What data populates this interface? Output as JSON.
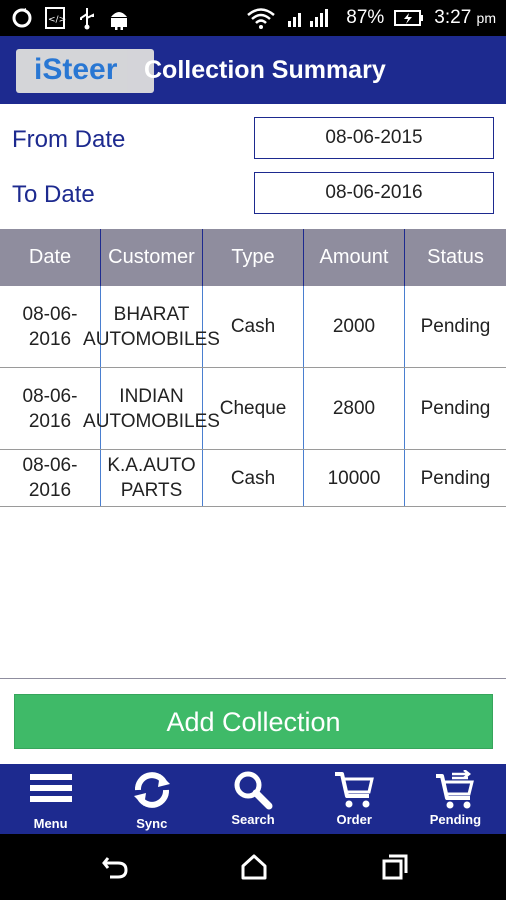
{
  "status_bar": {
    "battery": "87%",
    "time": "3:27",
    "ampm": "pm"
  },
  "header": {
    "logo": "iSteer",
    "title": "Collection Summary"
  },
  "filters": {
    "from_label": "From Date",
    "from_value": "08-06-2015",
    "to_label": "To Date",
    "to_value": "08-06-2016"
  },
  "table": {
    "columns": [
      "Date",
      "Customer",
      "Type",
      "Amount",
      "Status"
    ],
    "rows": [
      {
        "date": "08-06-2016",
        "customer": "BHARAT AUTOMOBILES",
        "type": "Cash",
        "amount": "2000",
        "status": "Pending"
      },
      {
        "date": "08-06-2016",
        "customer": "INDIAN AUTOMOBILES",
        "type": "Cheque",
        "amount": "2800",
        "status": "Pending"
      },
      {
        "date": "08-06-2016",
        "customer": "K.A.AUTO PARTS",
        "type": "Cash",
        "amount": "10000",
        "status": "Pending"
      }
    ]
  },
  "actions": {
    "add_collection": "Add Collection"
  },
  "bottom_nav": [
    {
      "label": "Menu",
      "icon": "menu-icon"
    },
    {
      "label": "Sync",
      "icon": "sync-icon"
    },
    {
      "label": "Search",
      "icon": "search-icon"
    },
    {
      "label": "Order",
      "icon": "cart-icon"
    },
    {
      "label": "Pending",
      "icon": "cart-transfer-icon"
    }
  ],
  "colors": {
    "header": "#1d2a8f",
    "table_header": "#8f8d9e",
    "button": "#3fba68",
    "label": "#1d2a8f"
  }
}
